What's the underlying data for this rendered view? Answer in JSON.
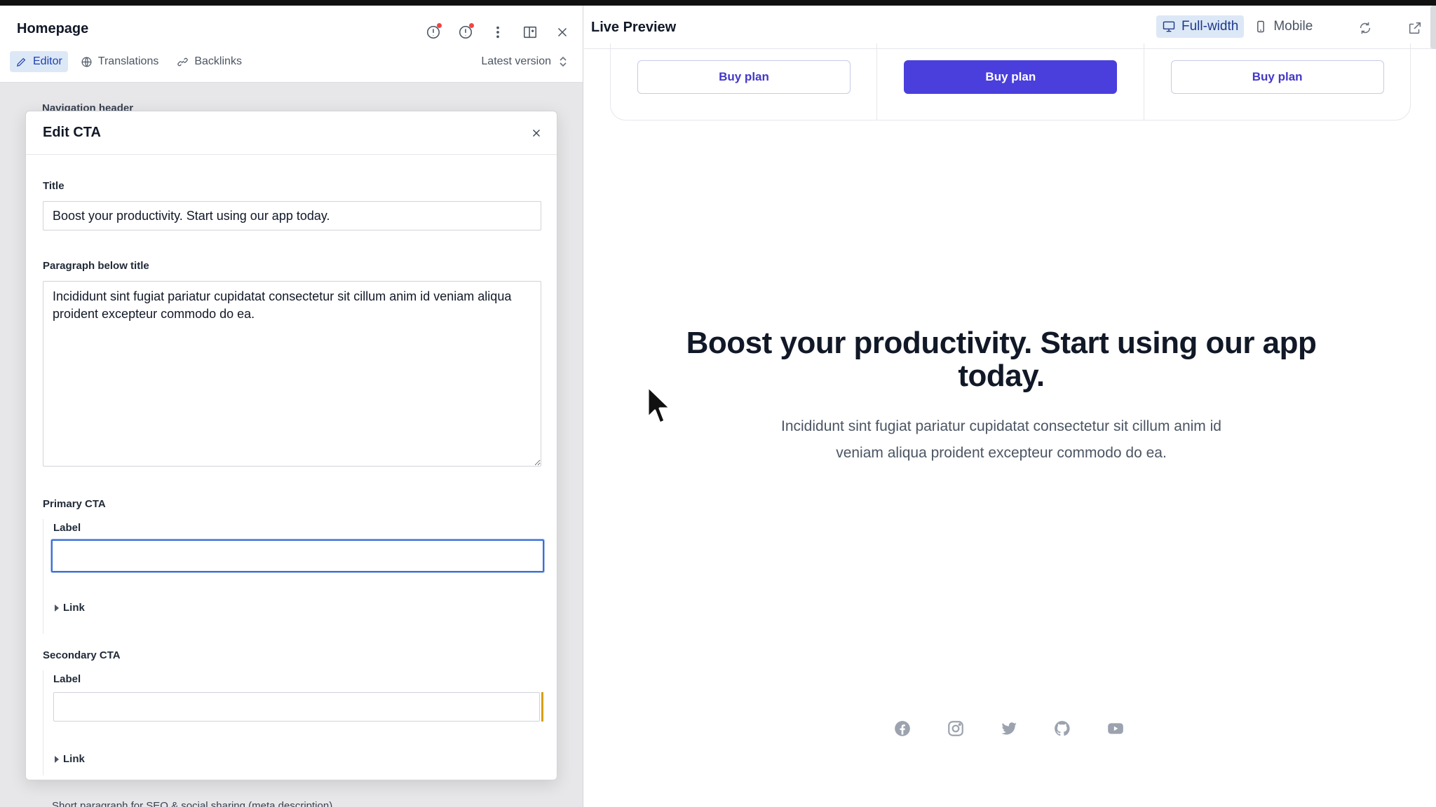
{
  "editor": {
    "doc_title": "Homepage",
    "tabs": [
      {
        "label": "Editor",
        "icon": "pencil-icon",
        "active": true
      },
      {
        "label": "Translations",
        "icon": "globe-icon",
        "active": false
      },
      {
        "label": "Backlinks",
        "icon": "link-icon",
        "active": false
      }
    ],
    "version_label": "Latest version",
    "bg_section_label": "Navigation header",
    "bg_bottom_label": "Short paragraph for SEO & social sharing (meta description)"
  },
  "dialog": {
    "title": "Edit CTA",
    "title_field": {
      "label": "Title",
      "value": "Boost your productivity. Start using our app today."
    },
    "paragraph_field": {
      "label": "Paragraph below title",
      "value": "Incididunt sint fugiat pariatur cupidatat consectetur sit cillum anim id veniam aliqua proident excepteur commodo do ea."
    },
    "primary_cta": {
      "heading": "Primary CTA",
      "label_title": "Label",
      "label_value": "",
      "link_label": "Link"
    },
    "secondary_cta": {
      "heading": "Secondary CTA",
      "label_title": "Label",
      "label_value": "",
      "link_label": "Link"
    }
  },
  "preview": {
    "title": "Live Preview",
    "view_modes": [
      {
        "label": "Full-width",
        "icon": "desktop-icon",
        "active": true
      },
      {
        "label": "Mobile",
        "icon": "mobile-icon",
        "active": false
      }
    ],
    "buy_buttons": [
      {
        "label": "Buy plan",
        "primary": false
      },
      {
        "label": "Buy plan",
        "primary": true
      },
      {
        "label": "Buy plan",
        "primary": false
      }
    ],
    "cta_heading": "Boost your productivity. Start using our app today.",
    "cta_paragraph": "Incididunt sint fugiat pariatur cupidatat consectetur sit cillum anim id veniam aliqua proident excepteur commodo do ea.",
    "social_icons": [
      "facebook-icon",
      "instagram-icon",
      "twitter-icon",
      "github-icon",
      "youtube-icon"
    ]
  },
  "colors": {
    "accent": "#4a3fdc",
    "active_tab_bg": "#dde8f7",
    "focus_border": "#3b6fd6",
    "notification_dot": "#ef4444",
    "social_gray": "#9ca3af"
  }
}
